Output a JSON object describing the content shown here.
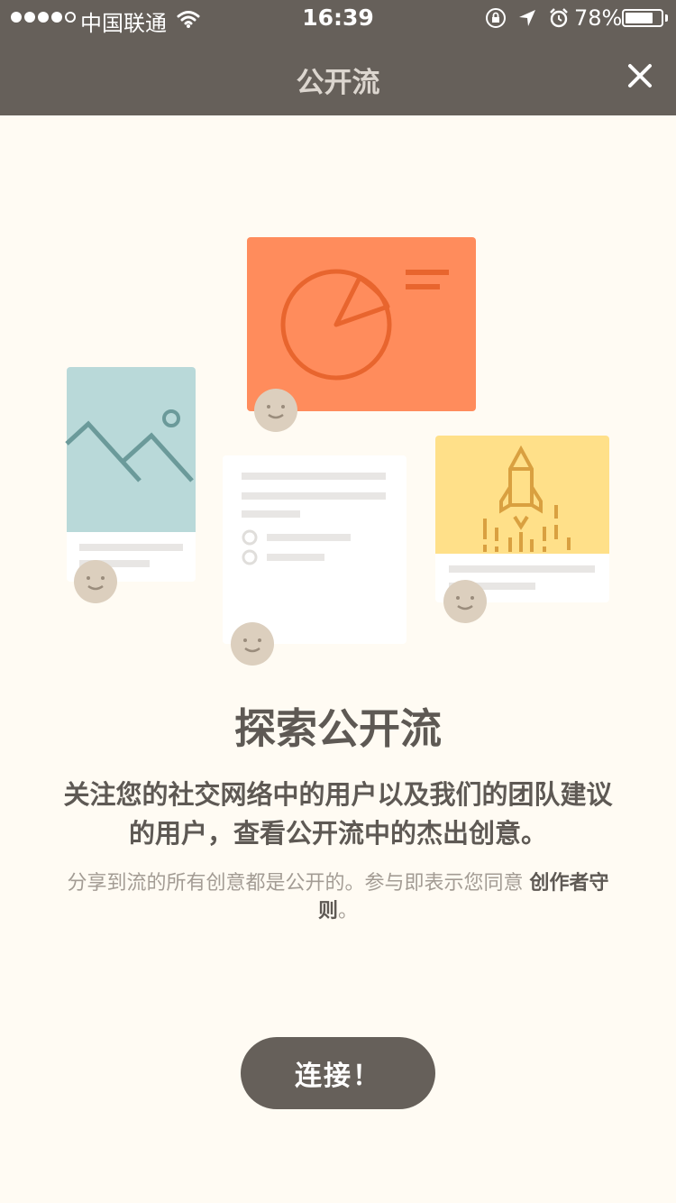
{
  "status_bar": {
    "carrier": "中国联通",
    "time": "16:39",
    "battery_percent": "78%",
    "battery_level": 0.78,
    "icons": [
      "signal-dots-icon",
      "wifi-icon",
      "orientation-lock-icon",
      "location-arrow-icon",
      "alarm-icon",
      "battery-icon"
    ]
  },
  "header": {
    "title": "公开流",
    "close_icon": "close-icon"
  },
  "main": {
    "heading": "探索公开流",
    "description": "关注您的社交网络中的用户以及我们的团队建议的用户，查看公开流中的杰出创意。",
    "terms_text": "分享到流的所有创意都是公开的。参与即表示您同意 ",
    "terms_link": "创作者守则",
    "terms_end": "。",
    "connect_button": "连接！"
  },
  "colors": {
    "header_bg": "#66605a",
    "page_bg": "#fffbf3",
    "orange_card": "#ff8c5c",
    "teal_card": "#b9d9d9",
    "yellow_card": "#ffe089",
    "avatar": "#dccfbe"
  },
  "illustration_icons": [
    "pie-chart-icon",
    "landscape-image-icon",
    "checklist-icon",
    "rocket-icon",
    "smiley-avatar-icon"
  ]
}
